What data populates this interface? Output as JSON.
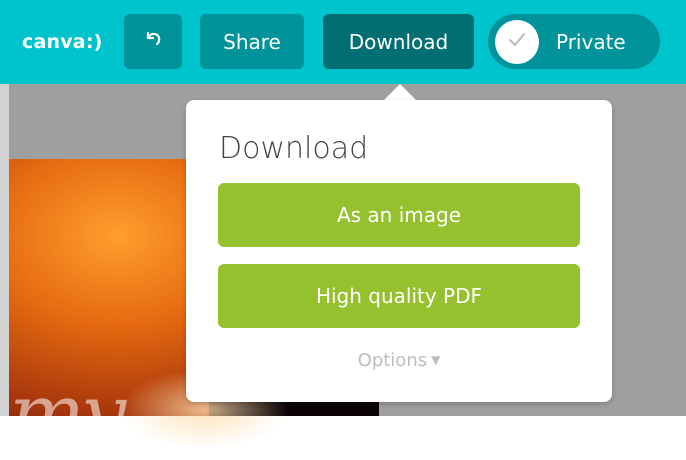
{
  "topbar": {
    "logo": "canva:)",
    "undo_icon": "undo-icon",
    "share_label": "Share",
    "download_label": "Download",
    "private_label": "Private",
    "private_icon": "checkmark-icon",
    "background_color": "#00c4cc",
    "button_color": "#00939a",
    "active_button_color": "#006e73"
  },
  "canvas": {
    "script_text": "my"
  },
  "download_popover": {
    "title": "Download",
    "as_image_label": "As an image",
    "pdf_label": "High quality PDF",
    "options_label": "Options",
    "options_icon": "caret-down-icon",
    "button_color": "#96c12f"
  }
}
